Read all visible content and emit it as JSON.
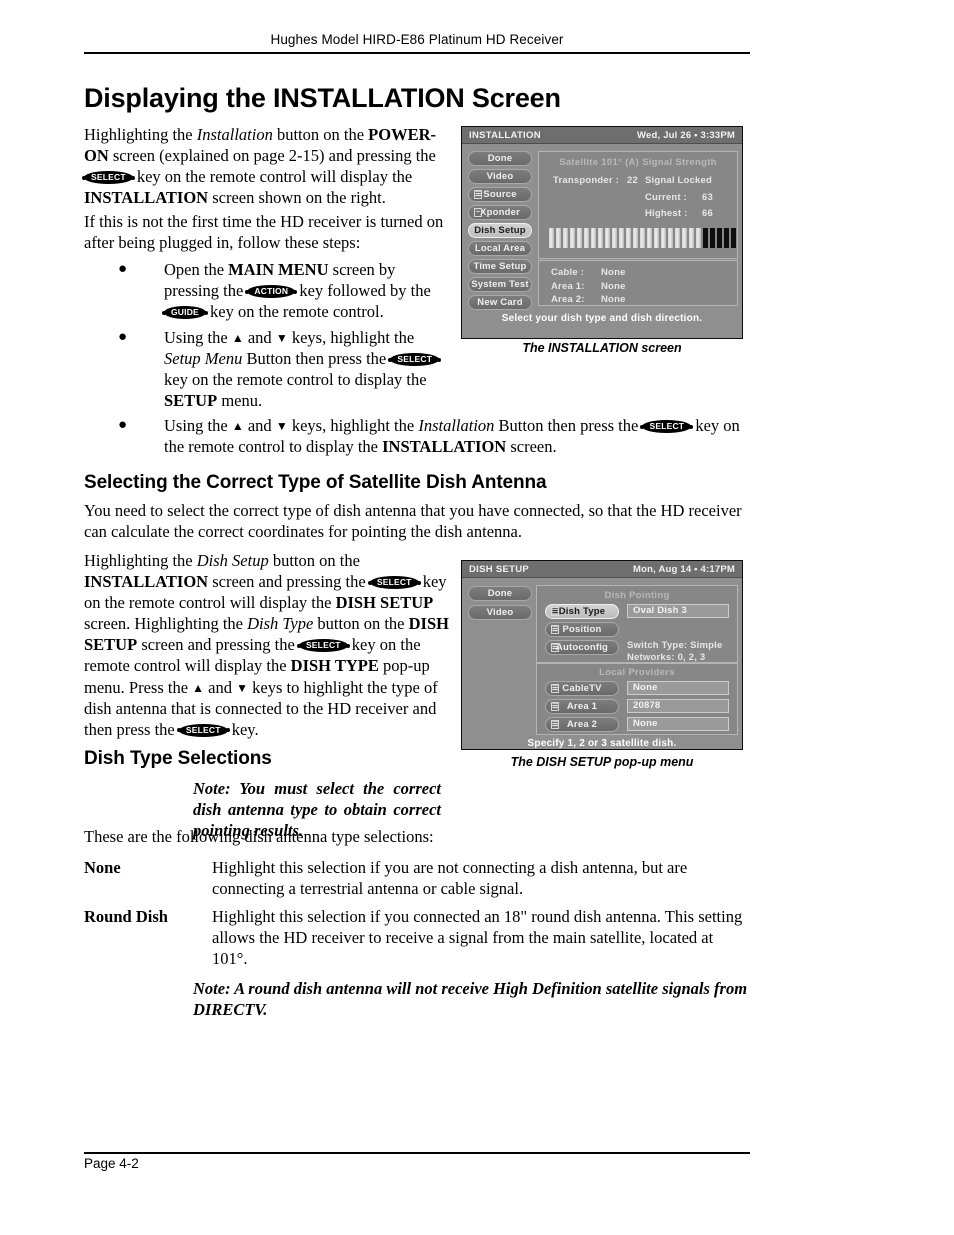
{
  "header": {
    "running_head": "Hughes Model HIRD-E86 Platinum HD Receiver"
  },
  "footer": {
    "page_label": "Page 4-2"
  },
  "headings": {
    "main": "Displaying the INSTALLATION Screen",
    "selecting": "Selecting the Correct Type of Satellite Dish Antenna",
    "dish_type_selections": "Dish Type Selections"
  },
  "body": {
    "intro_p1_a": "Highlighting the ",
    "intro_p1_install": "Installation",
    "intro_p1_b": " button on the ",
    "intro_p1_powerOn": "POWER-ON",
    "intro_p1_c": " screen (explained on page 2-15) and pressing the ",
    "key_select": "SELECT",
    "intro_p1_d": " key on the remote control will display the ",
    "intro_p1_installation": "INSTALLATION",
    "intro_p1_e": " screen shown on the right.",
    "intro_p2": "If this is not the first time the HD receiver is turned on after being plugged in, follow these steps:",
    "bullet1_a": "Open the ",
    "bullet1_mainmenu": "MAIN MENU",
    "bullet1_b": " screen by pressing the ",
    "key_action": "ACTION",
    "bullet1_c": " key followed by the ",
    "key_guide": "GUIDE",
    "bullet1_d": " key on the remote control.",
    "bullet2_a": "Using the ",
    "bullet2_b": " and ",
    "bullet2_c": " keys, highlight the ",
    "bullet2_setupmenu": "Setup Menu",
    "bullet2_d": " Button then press the ",
    "bullet2_e": " key on the remote control to display the ",
    "bullet2_setup": "SETUP",
    "bullet2_f": " menu.",
    "bullet3_c": " keys, highlight the ",
    "bullet3_installation": "Installation",
    "bullet3_d": " Button then press the ",
    "bullet3_e": " key on the remote control to display the ",
    "bullet3_screen": "INSTALLATION",
    "bullet3_f": " screen.",
    "selecting_p": "You need to select the correct type of dish antenna that you have connected, so that the HD receiver can calculate the correct coordinates for pointing the dish antenna.",
    "dishsetup_a": "Highlighting the ",
    "dishsetup_dishsetup": "Dish Setup",
    "dishsetup_b": " button on the ",
    "dishsetup_installation": "INSTALLATION",
    "dishsetup_c": " screen and pressing the ",
    "dishsetup_d": " key on the remote control will display the ",
    "dishsetup_DISHSETUP": "DISH SETUP",
    "dishsetup_e": " screen. Highlighting the ",
    "dishsetup_dishtype": "Dish Type",
    "dishsetup_f": " button on the ",
    "dishsetup_DISHSETUP2": "DISH SETUP",
    "dishsetup_g": " screen and pressing the ",
    "dishsetup_h": " key on the remote control will display the ",
    "dishsetup_DISHTYPE": "DISH TYPE",
    "dishsetup_i": " pop-up menu. Press the ",
    "dishsetup_j": " and ",
    "dishsetup_k": " keys to highlight the type of dish antenna that is connected to the HD receiver and then press the ",
    "dishsetup_l": " key.",
    "note_correct": "Note: You must select the correct dish antenna type to obtain correct pointing results.",
    "these_are": "These are the following dish antenna type selections:",
    "term_none": "None",
    "def_none": "Highlight this selection if you are not connecting a dish antenna, but are connecting a terrestrial antenna or cable signal.",
    "term_round": "Round Dish",
    "def_round": "Highlight this selection if you connected an 18\" round dish antenna. This setting allows the HD receiver to receive a signal from the main satellite, located at 101°.",
    "note_round": "Note: A round dish antenna will not receive High Definition satellite signals from DIRECTV."
  },
  "captions": {
    "installation": "The INSTALLATION screen",
    "dish_setup": "The DISH SETUP pop-up menu"
  },
  "installation_screen": {
    "title": "INSTALLATION",
    "clock": "Wed, Jul 26 • 3:33PM",
    "menu_buttons": [
      {
        "label": "Done",
        "glyph": "",
        "selected": false
      },
      {
        "label": "Video",
        "glyph": "",
        "selected": false
      },
      {
        "label": "Source",
        "glyph": "☰",
        "selected": false
      },
      {
        "label": "Xponder",
        "glyph": "~",
        "selected": false
      },
      {
        "label": "Dish Setup",
        "glyph": "",
        "selected": true
      },
      {
        "label": "Local Area",
        "glyph": "",
        "selected": false
      },
      {
        "label": "Time Setup",
        "glyph": "",
        "selected": false
      },
      {
        "label": "System Test",
        "glyph": "",
        "selected": false
      },
      {
        "label": "New Card",
        "glyph": "",
        "selected": false
      }
    ],
    "panel_title": "Satellite 101° (A) Signal Strength",
    "transponder_label": "Transponder :",
    "transponder_value": "22",
    "lock_status": "Signal Locked",
    "current_label": "Current :",
    "current_value": "63",
    "highest_label": "Highest :",
    "highest_value": "66",
    "bars_total": 27,
    "bars_filled": 22,
    "rows": [
      {
        "label": "Cable :",
        "value": "None"
      },
      {
        "label": "Area 1:",
        "value": "None"
      },
      {
        "label": "Area 2:",
        "value": "None"
      }
    ],
    "hint": "Select your dish type and dish direction."
  },
  "dish_setup_screen": {
    "title": "DISH SETUP",
    "clock": "Mon, Aug 14 • 4:17PM",
    "menu_buttons": [
      {
        "label": "Done",
        "selected": false
      },
      {
        "label": "Video",
        "selected": false
      }
    ],
    "section1_title": "Dish Pointing",
    "dish_type_button": "Dish Type",
    "dish_type_value": "Oval Dish 3",
    "position_button": "Position",
    "autoconfig_button": "Autoconfig",
    "switch_type": "Switch Type: Simple",
    "networks": "Networks: 0, 2, 3",
    "section2_title": "Local Providers",
    "providers": [
      {
        "button": "CableTV",
        "value": "None"
      },
      {
        "button": "Area 1",
        "value": "20878"
      },
      {
        "button": "Area 2",
        "value": "None"
      }
    ],
    "hint": "Specify 1, 2 or 3 satellite dish."
  },
  "colors": {
    "page_bg": "#ffffff",
    "ink": "#000000",
    "tv_bg": "#8f8f8f",
    "tv_titlebar": "#6e6e6e"
  }
}
